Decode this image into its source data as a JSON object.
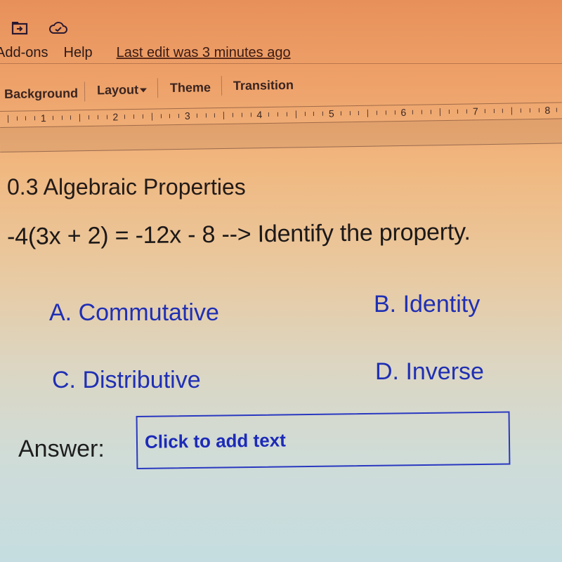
{
  "header": {
    "icons": [
      {
        "name": "move-to-folder-icon"
      },
      {
        "name": "cloud-saved-icon"
      }
    ],
    "menu": [
      "Add-ons",
      "Help"
    ],
    "last_edit": "Last edit was 3 minutes ago"
  },
  "toolbar": {
    "background_label": "Background",
    "layout_label": "Layout",
    "theme_label": "Theme",
    "transition_label": "Transition"
  },
  "ruler": {
    "numbers": [
      "1",
      "2",
      "3",
      "4",
      "5",
      "6",
      "7",
      "8"
    ]
  },
  "slide": {
    "title": "0.3 Algebraic Properties",
    "question": "-4(3x + 2) = -12x - 8 --> Identify the property.",
    "options": {
      "a": "A. Commutative",
      "b": "B. Identity",
      "c": "C. Distributive",
      "d": "D. Inverse"
    },
    "answer_label": "Answer:",
    "answer_placeholder": "Click to add text"
  },
  "colors": {
    "option_text": "#1f2fb4",
    "answer_box_border": "#2a38c0"
  }
}
